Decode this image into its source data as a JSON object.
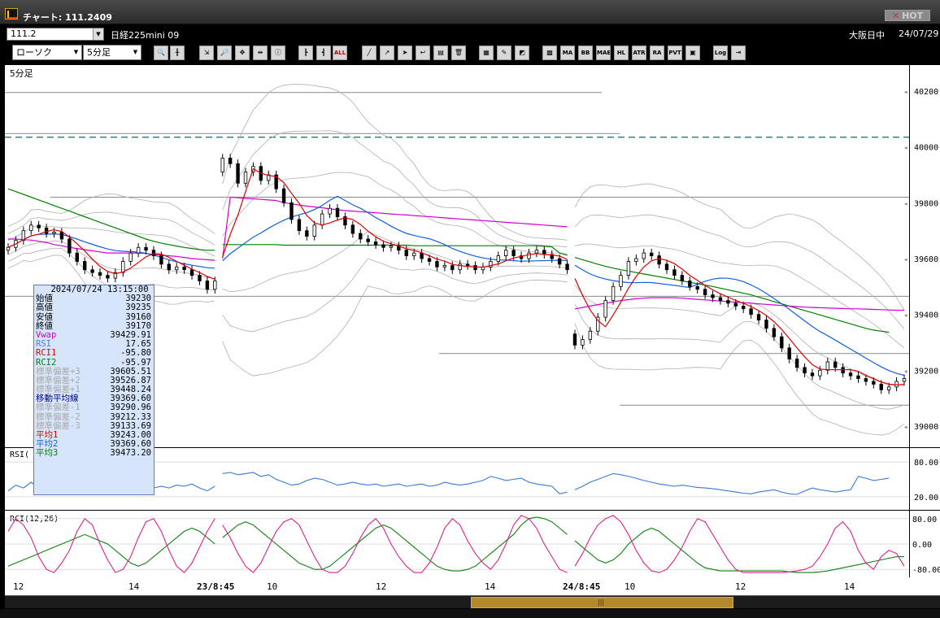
{
  "window": {
    "title": "チャート: 111.2409",
    "hot_label": "HOT"
  },
  "header": {
    "code": "111.2",
    "instrument": "日経225mini 09",
    "market": "大阪日中",
    "date": "24/07/29"
  },
  "toolbar": {
    "chart_type": "ローソク",
    "interval": "5分足",
    "text_buttons": [
      "ALL",
      "MA",
      "BB",
      "MAE",
      "HL",
      "ATR",
      "RA",
      "PVT",
      "Log"
    ]
  },
  "panels": {
    "price_label": "5分足",
    "rsi_label": "RSI(",
    "rci_label": "RCI(12,26)"
  },
  "colors": {
    "candle_up": "#ffffff",
    "candle_down": "#000000",
    "ma1": "#e00000",
    "ma2": "#1060e0",
    "ma3": "#008000",
    "vwap": "#d000d0",
    "bands": "#b0b0b0",
    "rsi": "#3a78d8",
    "rci1": "#e0208a",
    "rci2": "#108010",
    "level_line": "#1a7c7c"
  },
  "chart_data": {
    "type": "candlestick",
    "price_axis": {
      "ticks": [
        "40200",
        "40000",
        "39800",
        "39600",
        "39400",
        "39200",
        "39000"
      ],
      "ylim": [
        38930,
        40270
      ]
    },
    "rsi_axis": {
      "ticks": [
        "80.00",
        "20.00"
      ],
      "ylim": [
        0,
        100
      ]
    },
    "rci_axis": {
      "ticks": [
        "80.00",
        "0.00",
        "-80.00"
      ],
      "ylim": [
        -100,
        100
      ]
    },
    "x_axis_labels": [
      "12",
      "14",
      "23/8:45",
      "10",
      "12",
      "14",
      "24/8:45",
      "10",
      "12",
      "14"
    ],
    "level_line": 40035,
    "horizontal_lines": [
      {
        "y": 40195,
        "x_from": 0.0,
        "x_to": 0.66
      },
      {
        "y": 40048,
        "x_from": 0.0,
        "x_to": 0.68
      },
      {
        "y": 39820,
        "x_from": 0.05,
        "x_to": 1.0
      },
      {
        "y": 39465,
        "x_from": 0.0,
        "x_to": 1.0
      },
      {
        "y": 39260,
        "x_from": 0.48,
        "x_to": 1.0
      },
      {
        "y": 39075,
        "x_from": 0.68,
        "x_to": 1.0
      }
    ],
    "close": [
      39640,
      39665,
      39700,
      39720,
      39710,
      39690,
      39695,
      39670,
      39620,
      39590,
      39560,
      39550,
      39540,
      39530,
      39550,
      39590,
      39620,
      39640,
      39630,
      39610,
      39580,
      39560,
      39570,
      39560,
      39540,
      39520,
      39490,
      39520,
      39960,
      39940,
      39870,
      39910,
      39930,
      39880,
      39900,
      39850,
      39800,
      39740,
      39700,
      39680,
      39720,
      39760,
      39780,
      39750,
      39720,
      39690,
      39670,
      39660,
      39650,
      39640,
      39645,
      39630,
      39610,
      39620,
      39600,
      39590,
      39570,
      39575,
      39560,
      39580,
      39575,
      39560,
      39570,
      39590,
      39610,
      39630,
      39610,
      39600,
      39620,
      39630,
      39615,
      39600,
      39580,
      39560,
      39290,
      39310,
      39340,
      39390,
      39450,
      39500,
      39540,
      39590,
      39600,
      39620,
      39610,
      39580,
      39560,
      39540,
      39520,
      39500,
      39490,
      39470,
      39460,
      39450,
      39440,
      39430,
      39420,
      39400,
      39380,
      39350,
      39320,
      39280,
      39240,
      39210,
      39190,
      39180,
      39200,
      39230,
      39210,
      39190,
      39180,
      39170,
      39160,
      39150,
      39130,
      39140,
      39160,
      39170
    ],
    "vwap": [
      39670,
      39670,
      39668,
      39666,
      39662,
      39658,
      39650,
      39646,
      39640,
      39636,
      39632,
      39628,
      39624,
      39620,
      39620,
      39620,
      39620,
      39620,
      39618,
      39615,
      39612,
      39610,
      39608,
      39604,
      39600,
      39598,
      39596,
      39594,
      39600,
      39820,
      39818,
      39816,
      39814,
      39812,
      39810,
      39808,
      39800,
      39796,
      39792,
      39788,
      39785,
      39782,
      39778,
      39775,
      39772,
      39770,
      39768,
      39766,
      39764,
      39762,
      39760,
      39758,
      39756,
      39754,
      39752,
      39750,
      39748,
      39746,
      39744,
      39742,
      39740,
      39738,
      39736,
      39734,
      39732,
      39730,
      39728,
      39726,
      39724,
      39722,
      39720,
      39718,
      39716,
      39714,
      39420,
      39425,
      39430,
      39435,
      39440,
      39445,
      39450,
      39453,
      39456,
      39458,
      39460,
      39460,
      39460,
      39460,
      39458,
      39456,
      39454,
      39452,
      39450,
      39448,
      39446,
      39444,
      39442,
      39440,
      39438,
      39436,
      39434,
      39432,
      39430,
      39428,
      39426,
      39425,
      39424,
      39423,
      39422,
      39421,
      39420,
      39420,
      39419,
      39418,
      39417,
      39416,
      39415,
      39415
    ],
    "ma3": [
      39850,
      39840,
      39830,
      39820,
      39810,
      39800,
      39790,
      39780,
      39770,
      39760,
      39750,
      39740,
      39730,
      39720,
      39710,
      39700,
      39690,
      39680,
      39670,
      39662,
      39655,
      39650,
      39645,
      39640,
      39636,
      39632,
      39630,
      39630,
      39650,
      39650,
      39650,
      39650,
      39650,
      39650,
      39650,
      39650,
      39648,
      39648,
      39648,
      39648,
      39648,
      39648,
      39648,
      39648,
      39648,
      39648,
      39648,
      39648,
      39648,
      39648,
      39648,
      39648,
      39648,
      39646,
      39646,
      39646,
      39646,
      39646,
      39646,
      39646,
      39646,
      39646,
      39646,
      39646,
      39646,
      39646,
      39646,
      39646,
      39646,
      39646,
      39644,
      39642,
      39620,
      39612,
      39604,
      39596,
      39588,
      39580,
      39572,
      39566,
      39560,
      39555,
      39550,
      39545,
      39540,
      39535,
      39530,
      39525,
      39520,
      39515,
      39510,
      39505,
      39500,
      39494,
      39488,
      39482,
      39476,
      39470,
      39462,
      39454,
      39446,
      39438,
      39430,
      39422,
      39414,
      39406,
      39398,
      39390,
      39382,
      39374,
      39366,
      39358,
      39350,
      39344,
      39340,
      39336
    ],
    "rsi": [
      30,
      40,
      35,
      45,
      35,
      30,
      32,
      28,
      30,
      38,
      32,
      35,
      40,
      38,
      35,
      40,
      45,
      42,
      40,
      35,
      38,
      35,
      40,
      38,
      42,
      35,
      30,
      38,
      60,
      62,
      58,
      60,
      62,
      55,
      58,
      50,
      45,
      40,
      42,
      48,
      52,
      50,
      45,
      40,
      42,
      45,
      42,
      40,
      42,
      38,
      40,
      42,
      38,
      40,
      42,
      38,
      40,
      45,
      42,
      40,
      42,
      45,
      48,
      55,
      52,
      48,
      50,
      52,
      45,
      42,
      40,
      38,
      25,
      28,
      32,
      38,
      45,
      50,
      55,
      60,
      58,
      55,
      52,
      48,
      45,
      42,
      40,
      38,
      40,
      38,
      36,
      35,
      34,
      32,
      30,
      28,
      26,
      25,
      28,
      30,
      32,
      28,
      25,
      24,
      30,
      35,
      32,
      30,
      28,
      30,
      32,
      55,
      52,
      48,
      50,
      52
    ],
    "rci1": [
      40,
      80,
      60,
      20,
      -40,
      -80,
      -90,
      -60,
      -20,
      40,
      80,
      60,
      0,
      -50,
      -90,
      -80,
      -40,
      20,
      70,
      80,
      40,
      -20,
      -70,
      -90,
      -60,
      -10,
      40,
      80,
      60,
      20,
      -30,
      -70,
      -90,
      -60,
      -10,
      40,
      70,
      80,
      60,
      10,
      -40,
      -80,
      -90,
      -90,
      -70,
      -30,
      20,
      60,
      80,
      50,
      0,
      -40,
      -70,
      -90,
      -90,
      -60,
      -10,
      50,
      80,
      60,
      10,
      -30,
      -60,
      -80,
      -50,
      0,
      60,
      90,
      80,
      50,
      0,
      -40,
      -80,
      -90,
      -70,
      -30,
      20,
      60,
      80,
      90,
      70,
      30,
      -20,
      -60,
      -85,
      -90,
      -80,
      -50,
      -10,
      40,
      80,
      70,
      30,
      -10,
      -50,
      -80,
      -90,
      -90,
      -90,
      -90,
      -90,
      -90,
      -88,
      -85,
      -80,
      -70,
      -40,
      0,
      50,
      70,
      40,
      -20,
      -60,
      -80,
      -40,
      -20,
      -30,
      -70
    ],
    "rci2": [
      -70,
      -60,
      -50,
      -40,
      -30,
      -20,
      -10,
      0,
      10,
      20,
      30,
      20,
      10,
      0,
      -20,
      -40,
      -60,
      -70,
      -60,
      -40,
      -20,
      0,
      20,
      40,
      50,
      40,
      20,
      0,
      20,
      40,
      60,
      70,
      60,
      40,
      20,
      0,
      -20,
      -40,
      -60,
      -70,
      -80,
      -80,
      -70,
      -50,
      -30,
      -10,
      10,
      30,
      50,
      60,
      50,
      30,
      10,
      -10,
      -30,
      -50,
      -70,
      -80,
      -85,
      -85,
      -80,
      -70,
      -50,
      -30,
      -10,
      10,
      30,
      60,
      80,
      85,
      80,
      70,
      50,
      30,
      10,
      -10,
      -30,
      -50,
      -60,
      -50,
      -30,
      0,
      20,
      40,
      50,
      40,
      20,
      0,
      -20,
      -40,
      -60,
      -75,
      -80,
      -85,
      -85,
      -85,
      -85,
      -85,
      -85,
      -85,
      -85,
      -85,
      -88,
      -90,
      -90,
      -90,
      -88,
      -85,
      -80,
      -75,
      -70,
      -65,
      -60,
      -55,
      -50,
      -45,
      -40,
      -40,
      -45,
      -50,
      -55,
      -60
    ]
  },
  "info_panel": {
    "datetime": "2024/07/24 13:15:00",
    "rows": [
      {
        "label": "始値",
        "value": "39230",
        "color": "#000000"
      },
      {
        "label": "高値",
        "value": "39235",
        "color": "#000000"
      },
      {
        "label": "安値",
        "value": "39160",
        "color": "#000000"
      },
      {
        "label": "終値",
        "value": "39170",
        "color": "#000000"
      },
      {
        "label": "Vwap",
        "value": "39429.91",
        "color": "#d000d0"
      },
      {
        "label": "RSI",
        "value": "17.65",
        "color": "#4a7fe0"
      },
      {
        "label": "RCI1",
        "value": "-95.80",
        "color": "#e00000"
      },
      {
        "label": "RCI2",
        "value": "-95.97",
        "color": "#008000"
      },
      {
        "label": "標準偏差+3",
        "value": "39605.51",
        "color": "#a8a8a8"
      },
      {
        "label": "標準偏差+2",
        "value": "39526.87",
        "color": "#a8a8a8"
      },
      {
        "label": "標準偏差+1",
        "value": "39448.24",
        "color": "#a8a8a8"
      },
      {
        "label": "移動平均線",
        "value": "39369.60",
        "color": "#00008b"
      },
      {
        "label": "標準偏差-1",
        "value": "39290.96",
        "color": "#a8a8a8"
      },
      {
        "label": "標準偏差-2",
        "value": "39212.33",
        "color": "#a8a8a8"
      },
      {
        "label": "標準偏差-3",
        "value": "39133.69",
        "color": "#a8a8a8"
      },
      {
        "label": "平均1",
        "value": "39243.00",
        "color": "#e00000"
      },
      {
        "label": "平均2",
        "value": "39369.60",
        "color": "#1060e0"
      },
      {
        "label": "平均3",
        "value": "39473.20",
        "color": "#008000"
      }
    ]
  }
}
